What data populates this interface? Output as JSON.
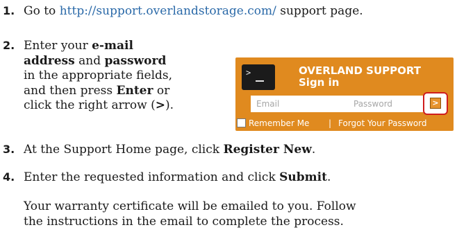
{
  "steps": [
    {
      "number": "1.",
      "parts": [
        "Go to ",
        "http://support.overlandstorage.com/",
        " support page."
      ]
    },
    {
      "number": "2.",
      "lines": [
        [
          "Enter your ",
          "e-mail"
        ],
        [
          "address",
          " and ",
          "password"
        ],
        [
          "in the appropriate fields,"
        ],
        [
          "and then press ",
          "Enter",
          " or"
        ],
        [
          "click the right arrow (",
          ">",
          ")."
        ]
      ]
    },
    {
      "number": "3.",
      "parts": [
        "At the Support Home page, click ",
        "Register New",
        "."
      ]
    },
    {
      "number": "4.",
      "parts": [
        "Enter the requested information and click ",
        "Submit",
        "."
      ],
      "note_lines": [
        "Your warranty certificate will be emailed to you. Follow",
        "the instructions in the email to complete the process."
      ]
    }
  ],
  "signin_widget": {
    "icon": "terminal-icon",
    "icon_prompt": ">_",
    "title": "OVERLAND SUPPORT",
    "subtitle": "Sign in",
    "email_placeholder": "Email",
    "password_placeholder": "Password",
    "submit_glyph": ">",
    "remember_label": "Remember Me",
    "separator": "|",
    "forgot_label": "Forgot Your Password",
    "colors": {
      "background": "#e08a1f",
      "highlight": "#cf1d1d",
      "link": "#2a69a8"
    }
  }
}
